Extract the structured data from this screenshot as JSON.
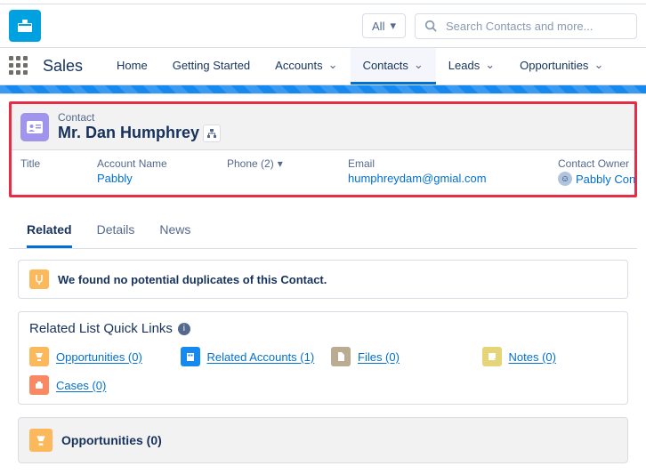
{
  "search": {
    "filter": "All",
    "placeholder": "Search Contacts and more..."
  },
  "app_name": "Sales",
  "nav": [
    {
      "label": "Home",
      "has_chev": false
    },
    {
      "label": "Getting Started",
      "has_chev": false
    },
    {
      "label": "Accounts",
      "has_chev": true
    },
    {
      "label": "Contacts",
      "has_chev": true,
      "active": true
    },
    {
      "label": "Leads",
      "has_chev": true
    },
    {
      "label": "Opportunities",
      "has_chev": true
    }
  ],
  "record": {
    "type": "Contact",
    "name": "Mr. Dan Humphrey",
    "fields": {
      "title_lbl": "Title",
      "title_val": "",
      "account_lbl": "Account Name",
      "account_val": "Pabbly",
      "phone_lbl": "Phone (2)",
      "email_lbl": "Email",
      "email_val": "humphreydam@gmial.com",
      "owner_lbl": "Contact Owner",
      "owner_val": "Pabbly Con"
    }
  },
  "tabs": {
    "related": "Related",
    "details": "Details",
    "news": "News"
  },
  "duplicates_msg": "We found no potential duplicates of this Contact.",
  "rlql_title": "Related List Quick Links",
  "quicklinks": {
    "opportunities": "Opportunities (0)",
    "related_accounts": "Related Accounts (1)",
    "files": "Files (0)",
    "notes": "Notes (0)",
    "cases": "Cases (0)"
  },
  "opp_section": "Opportunities (0)"
}
